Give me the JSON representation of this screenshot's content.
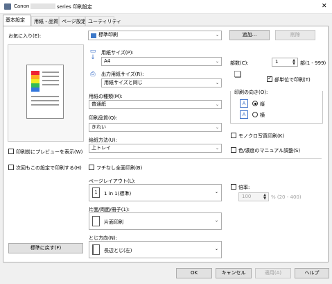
{
  "window": {
    "title_prefix": "Canon",
    "title_suffix": "series 印刷設定",
    "close_glyph": "✕"
  },
  "tabs": [
    {
      "label": "基本設定"
    },
    {
      "label": "用紙・品質"
    },
    {
      "label": "ページ設定"
    },
    {
      "label": "ユーティリティ"
    }
  ],
  "favorites": {
    "label": "お気に入り(E):",
    "value": "標準印刷",
    "add_label": "追加...",
    "delete_label": "削除"
  },
  "page_size": {
    "label": "用紙サイズ(P):",
    "value": "A4"
  },
  "output_size": {
    "label": "出力用紙サイズ(R):",
    "value": "用紙サイズと同じ"
  },
  "media_type": {
    "label": "用紙の種類(M):",
    "value": "普通紙"
  },
  "print_quality": {
    "label": "印刷品質(Q):",
    "value": "きれい"
  },
  "paper_source": {
    "label": "給紙方法(U):",
    "value": "上トレイ"
  },
  "copies": {
    "label": "部数(C):",
    "value": "1",
    "range": "部(1 - 999)",
    "collate_label": "部単位で印刷(T)"
  },
  "orientation": {
    "label": "印刷の向き(O):",
    "portrait_label": "縦",
    "landscape_label": "横"
  },
  "grayscale": {
    "label": "モノクロ写真印刷(K)"
  },
  "color_manual": {
    "label": "色/濃度のマニュアル調整(S)"
  },
  "preview": {
    "preview_label": "印刷前にプレビューを表示(W)",
    "next_label": "次回もこの設定で印刷する(H)",
    "defaults_label": "標準に戻す(F)"
  },
  "borderless": {
    "label": "フチなし全面印刷(B)"
  },
  "page_layout": {
    "label": "ページレイアウト(L):",
    "value": "1 in 1(標準)",
    "icon_text": "1"
  },
  "duplex": {
    "label": "片面/両面/冊子(1):",
    "value": "片面印刷"
  },
  "binding": {
    "label": "とじ方向(N):",
    "value": "長辺とじ(左)"
  },
  "scaling": {
    "label": "倍率:",
    "value": "100",
    "range": "% (20 - 400)"
  },
  "footer": {
    "ok": "OK",
    "cancel": "キャンセル",
    "apply": "適用(A)",
    "help": "ヘルプ"
  }
}
